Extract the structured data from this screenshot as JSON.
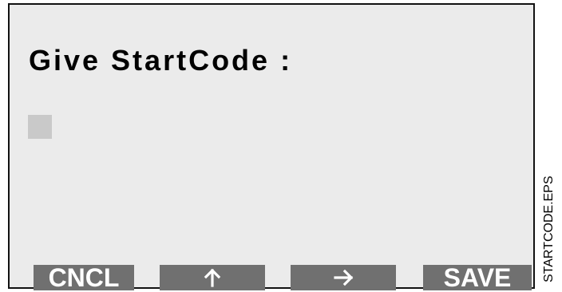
{
  "screen": {
    "prompt": "Give StartCode :",
    "input": {
      "value": ""
    },
    "softkeys": {
      "cancel_label": "CNCL",
      "up_icon": "arrow-up-icon",
      "right_icon": "arrow-right-icon",
      "save_label": "SAVE"
    }
  },
  "figure_label": "STARTCODE.EPS",
  "colors": {
    "screen_background": "#ebebeb",
    "softkey_background": "#707070",
    "softkey_text": "#ffffff",
    "cursor_block": "#c9c9c9"
  }
}
